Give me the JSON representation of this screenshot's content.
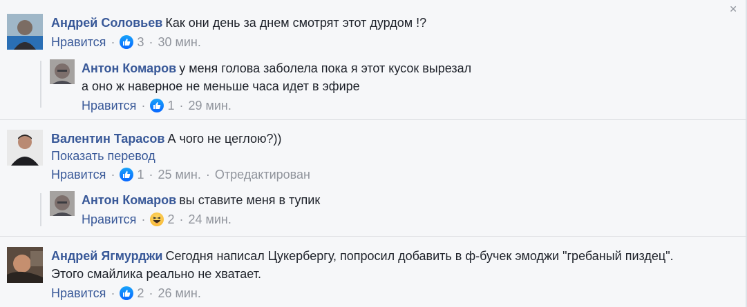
{
  "comments": [
    {
      "author": "Андрей Соловьев",
      "text": "Как они день за днем смотрят этот дурдом !?",
      "like_label": "Нравится",
      "reaction": "like",
      "reaction_count": "3",
      "time": "30 мин.",
      "replies": [
        {
          "author": "Антон Комаров",
          "text_lines": [
            "у меня голова заболела пока я этот кусок вырезал",
            "а оно ж наверное не меньше часа идет в эфире"
          ],
          "like_label": "Нравится",
          "reaction": "like",
          "reaction_count": "1",
          "time": "29 мин."
        }
      ]
    },
    {
      "author": "Валентин Тарасов",
      "text": "А чого не цеглою?))",
      "translate_label": "Показать перевод",
      "like_label": "Нравится",
      "reaction": "like",
      "reaction_count": "1",
      "time": "25 мин.",
      "edited_label": "Отредактирован",
      "replies": [
        {
          "author": "Антон Комаров",
          "text_lines": [
            "вы ставите меня в тупик"
          ],
          "like_label": "Нравится",
          "reaction": "haha",
          "reaction_count": "2",
          "time": "24 мин."
        }
      ]
    },
    {
      "author": "Андрей Ягмурджи",
      "text_lines": [
        "Сегодня написал Цукербергу, попросил добавить в ф-бучек эмоджи \"гребаный пиздец\".",
        "Этого смайлика реально не хватает."
      ],
      "like_label": "Нравится",
      "reaction": "like",
      "reaction_count": "2",
      "time": "26 мин.",
      "replies": []
    }
  ],
  "separator": "·",
  "colors": {
    "author_link": "#385898",
    "meta_text": "#90949c",
    "background": "#f6f7f9",
    "like_blue": "#0766ff"
  }
}
